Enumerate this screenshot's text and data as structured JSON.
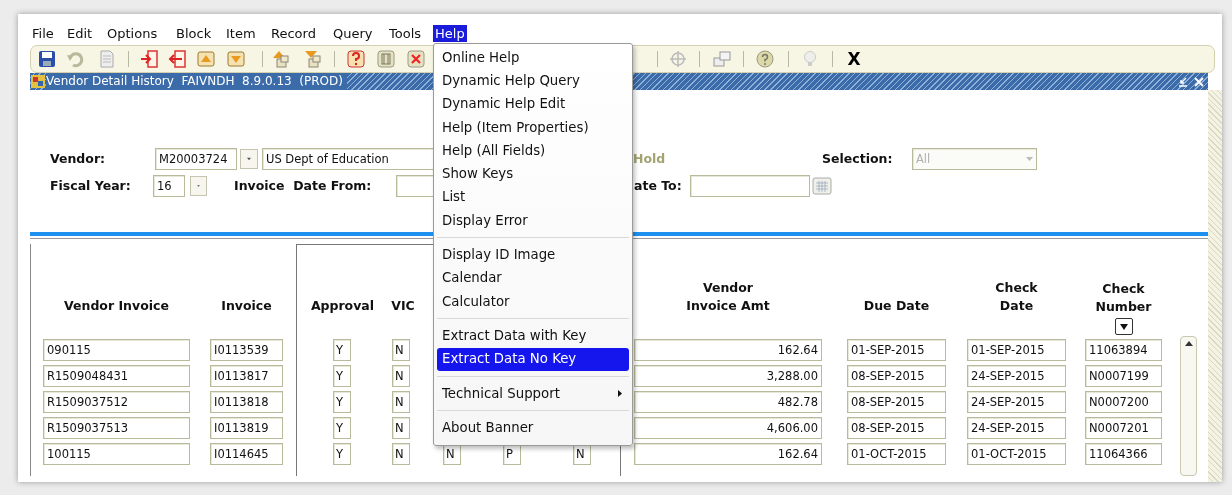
{
  "menubar": [
    {
      "label": "File",
      "selected": false
    },
    {
      "label": "Edit",
      "selected": false
    },
    {
      "label": "Options",
      "selected": false
    },
    {
      "label": "Block",
      "selected": false
    },
    {
      "label": "Item",
      "selected": false
    },
    {
      "label": "Record",
      "selected": false
    },
    {
      "label": "Query",
      "selected": false
    },
    {
      "label": "Tools",
      "selected": false
    },
    {
      "label": "Help",
      "selected": true
    }
  ],
  "toolbar": {
    "exit_label": "X"
  },
  "window": {
    "title": "Vendor Detail History  FAIVNDH  8.9.0.13  (PROD)"
  },
  "form": {
    "vendor": {
      "label": "Vendor:",
      "id": "M20003724",
      "name": "US Dept of Education"
    },
    "hold": {
      "label": "Hold"
    },
    "selection": {
      "label": "Selection:",
      "value": "All",
      "disabled": true
    },
    "fiscal_year": {
      "label": "Fiscal Year:",
      "value": "16"
    },
    "invoice_date_from": {
      "label": "Invoice  Date From:"
    },
    "date_to": {
      "label": "ate To:"
    }
  },
  "table": {
    "columns": [
      "Vendor Invoice",
      "Invoice",
      "Approval",
      "VIC",
      "Vendor Invoice Amt",
      "Due Date",
      "Check Date",
      "Check Number"
    ],
    "rows": [
      {
        "vendor_invoice": "090115",
        "invoice": "I0113539",
        "approval": "Y",
        "vic": "N",
        "vendor_invoice_amt": "162.64",
        "due_date": "01-SEP-2015",
        "check_date": "01-SEP-2015",
        "check_number": "11063894"
      },
      {
        "vendor_invoice": "R1509048431",
        "invoice": "I0113817",
        "approval": "Y",
        "vic": "N",
        "vendor_invoice_amt": "3,288.00",
        "due_date": "08-SEP-2015",
        "check_date": "24-SEP-2015",
        "check_number": "N0007199"
      },
      {
        "vendor_invoice": "R1509037512",
        "invoice": "I0113818",
        "approval": "Y",
        "vic": "N",
        "vendor_invoice_amt": "482.78",
        "due_date": "08-SEP-2015",
        "check_date": "24-SEP-2015",
        "check_number": "N0007200"
      },
      {
        "vendor_invoice": "R1509037513",
        "invoice": "I0113819",
        "approval": "Y",
        "vic": "N",
        "vendor_invoice_amt": "4,606.00",
        "due_date": "08-SEP-2015",
        "check_date": "24-SEP-2015",
        "check_number": "N0007201"
      },
      {
        "vendor_invoice": "100115",
        "invoice": "I0114645",
        "approval": "Y",
        "vic": "N",
        "column_5": "N",
        "column_6": "P",
        "column_7": "N",
        "vendor_invoice_amt": "162.64",
        "due_date": "01-OCT-2015",
        "check_date": "01-OCT-2015",
        "check_number": "11064366"
      }
    ]
  },
  "help_menu": {
    "items": [
      {
        "kind": "item",
        "label": "Online Help",
        "selected": false
      },
      {
        "kind": "item",
        "label": "Dynamic Help Query",
        "selected": false
      },
      {
        "kind": "item",
        "label": "Dynamic Help Edit",
        "selected": false
      },
      {
        "kind": "item",
        "label": "Help (Item Properties)",
        "selected": false
      },
      {
        "kind": "item",
        "label": "Help (All Fields)",
        "selected": false
      },
      {
        "kind": "item",
        "label": "Show Keys",
        "selected": false
      },
      {
        "kind": "item",
        "label": "List",
        "selected": false
      },
      {
        "kind": "item",
        "label": "Display Error",
        "selected": false
      },
      {
        "kind": "separator"
      },
      {
        "kind": "item",
        "label": "Display ID Image",
        "selected": false
      },
      {
        "kind": "item",
        "label": "Calendar",
        "selected": false
      },
      {
        "kind": "item",
        "label": "Calculator",
        "selected": false
      },
      {
        "kind": "separator"
      },
      {
        "kind": "item",
        "label": "Extract Data with Key",
        "selected": false
      },
      {
        "kind": "item",
        "label": "Extract Data No Key",
        "selected": true
      },
      {
        "kind": "separator"
      },
      {
        "kind": "submenu",
        "label": "Technical Support",
        "selected": false
      },
      {
        "kind": "separator"
      },
      {
        "kind": "item",
        "label": "About Banner",
        "selected": false
      }
    ]
  }
}
